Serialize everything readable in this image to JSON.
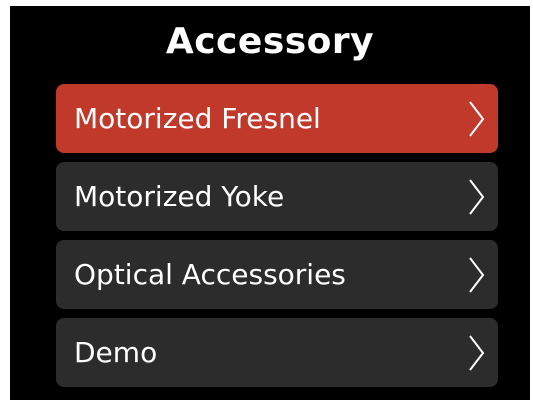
{
  "screen": {
    "title": "Accessory"
  },
  "menu": {
    "items": [
      {
        "label": "Motorized Fresnel",
        "selected": true,
        "icon": "chevron-right-icon"
      },
      {
        "label": "Motorized Yoke",
        "selected": false,
        "icon": "chevron-right-icon"
      },
      {
        "label": "Optical Accessories",
        "selected": false,
        "icon": "chevron-right-icon"
      },
      {
        "label": "Demo",
        "selected": false,
        "icon": "chevron-right-icon"
      }
    ]
  },
  "colors": {
    "background": "#000000",
    "item_background": "#2c2c2c",
    "selected_background": "#c0392b",
    "text": "#ffffff"
  }
}
